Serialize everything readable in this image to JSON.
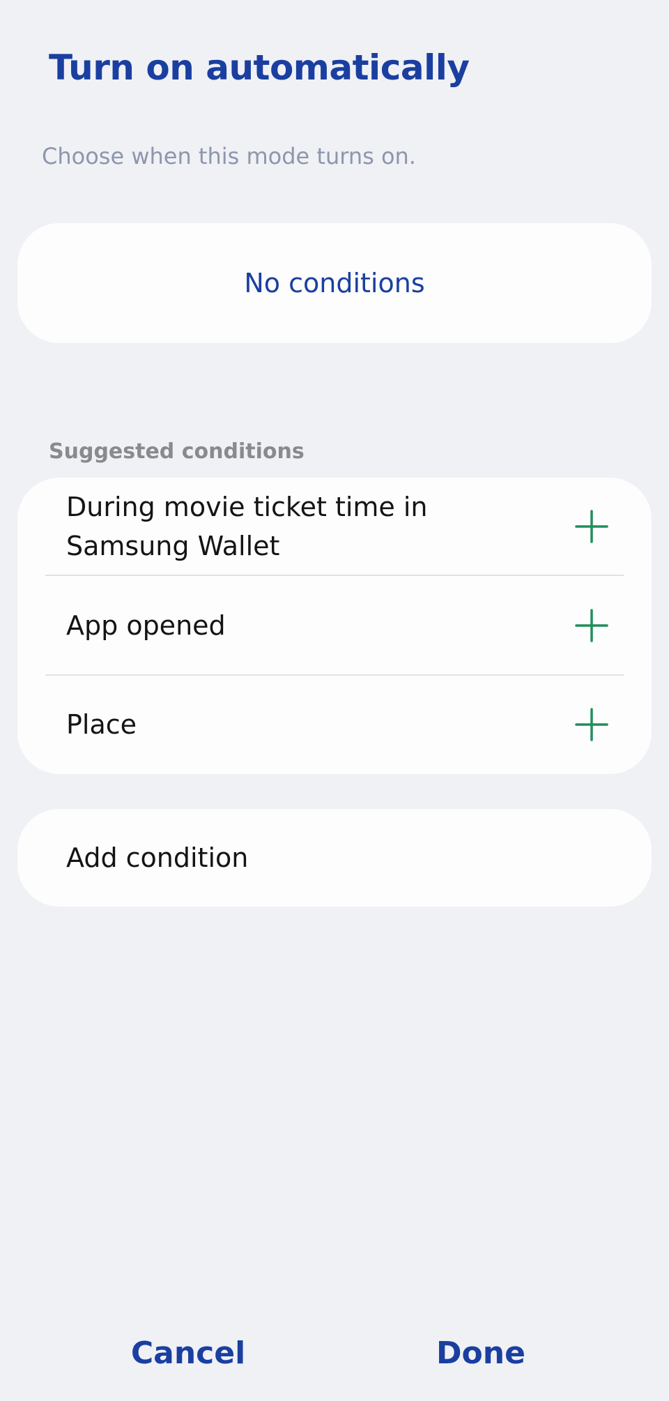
{
  "header": {
    "title": "Turn on automatically",
    "subtitle": "Choose when this mode turns on."
  },
  "conditions": {
    "empty_label": "No conditions"
  },
  "suggested": {
    "section_title": "Suggested conditions",
    "items": [
      {
        "label": "During movie ticket time in Samsung Wallet",
        "icon": "plus-icon"
      },
      {
        "label": "App opened",
        "icon": "plus-icon"
      },
      {
        "label": "Place",
        "icon": "plus-icon"
      }
    ]
  },
  "add_condition": {
    "label": "Add condition"
  },
  "footer": {
    "cancel_label": "Cancel",
    "done_label": "Done"
  },
  "colors": {
    "accent": "#1a3fa0",
    "plus_icon": "#1e8f5a",
    "background": "#f0f1f5",
    "card": "#fdfdfd"
  }
}
